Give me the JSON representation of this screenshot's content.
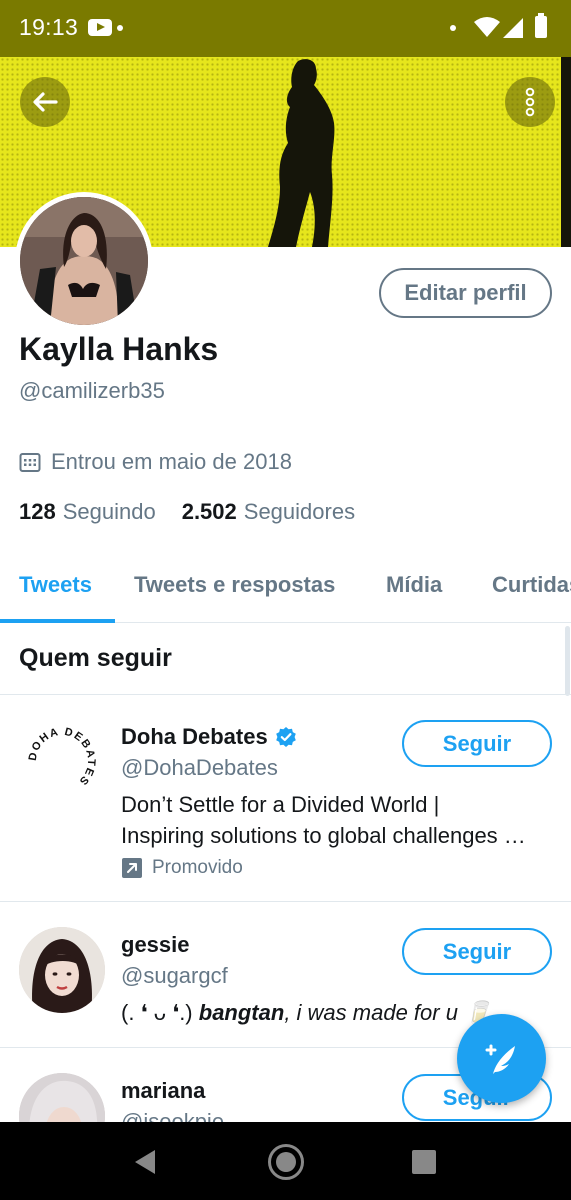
{
  "status_bar": {
    "time": "19:13"
  },
  "profile": {
    "display_name": "Kaylla Hanks",
    "handle": "@camilizerb35",
    "edit_button": "Editar perfil",
    "joined": "Entrou em maio de 2018",
    "following_count": "128",
    "following_label": "Seguindo",
    "followers_count": "2.502",
    "followers_label": "Seguidores"
  },
  "tabs": [
    {
      "label": "Tweets",
      "active": true
    },
    {
      "label": "Tweets e respostas",
      "active": false
    },
    {
      "label": "Mídia",
      "active": false
    },
    {
      "label": "Curtidas",
      "active": false
    }
  ],
  "who_to_follow": {
    "title": "Quem seguir",
    "items": [
      {
        "name": "Doha Debates",
        "verified": true,
        "handle": "@DohaDebates",
        "bio_line1": "Don’t Settle for a Divided World |",
        "bio_line2": "Inspiring solutions to global challenges …",
        "promoted": "Promovido",
        "follow_label": "Seguir",
        "avatar_text": "DOHA DEBATES"
      },
      {
        "name": "gessie",
        "handle": "@sugargcf",
        "bio_prefix": "(. ❛ ᴗ ❛.) ",
        "bio_bold": "bangtan",
        "bio_rest": ", i was made for u 🥛",
        "follow_label": "Seguir"
      },
      {
        "name": "mariana",
        "handle": "@iseokpie",
        "follow_label": "Seguir"
      }
    ]
  },
  "colors": {
    "accent": "#1da1f2",
    "status_bar": "#7a7a00",
    "banner": "#e6e61c",
    "secondary_text": "#657786"
  },
  "icons": {
    "back": "arrow-left-icon",
    "more": "more-vertical-icon",
    "calendar": "calendar-icon",
    "verified": "verified-badge-icon",
    "promoted": "promoted-arrow-icon",
    "compose": "compose-tweet-icon"
  }
}
